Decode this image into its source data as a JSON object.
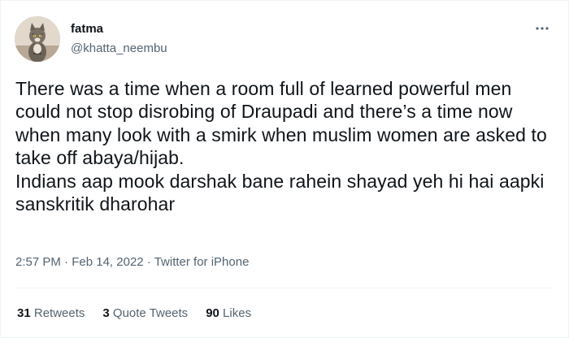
{
  "author": {
    "display_name": "fatma",
    "handle": "@khatta_neembu"
  },
  "tweet": {
    "text": "There was a time when a room full of learned powerful men could not stop disrobing of Draupadi and there’s a time now when many look with a smirk when muslim women are asked to take off abaya/hijab.\nIndians aap mook darshak bane rahein shayad yeh hi hai aapki sanskritik dharohar",
    "time": "2:57 PM",
    "date": "Feb 14, 2022",
    "source": "Twitter for iPhone",
    "separator": "·"
  },
  "stats": {
    "retweets_count": "31",
    "retweets_label": "Retweets",
    "quote_tweets_count": "3",
    "quote_tweets_label": "Quote Tweets",
    "likes_count": "90",
    "likes_label": "Likes"
  },
  "icons": {
    "more": "more-horizontal-icon",
    "avatar": "cat-avatar"
  },
  "colors": {
    "text_primary": "#0f1419",
    "text_secondary": "#536471",
    "divider": "#eff3f4"
  }
}
